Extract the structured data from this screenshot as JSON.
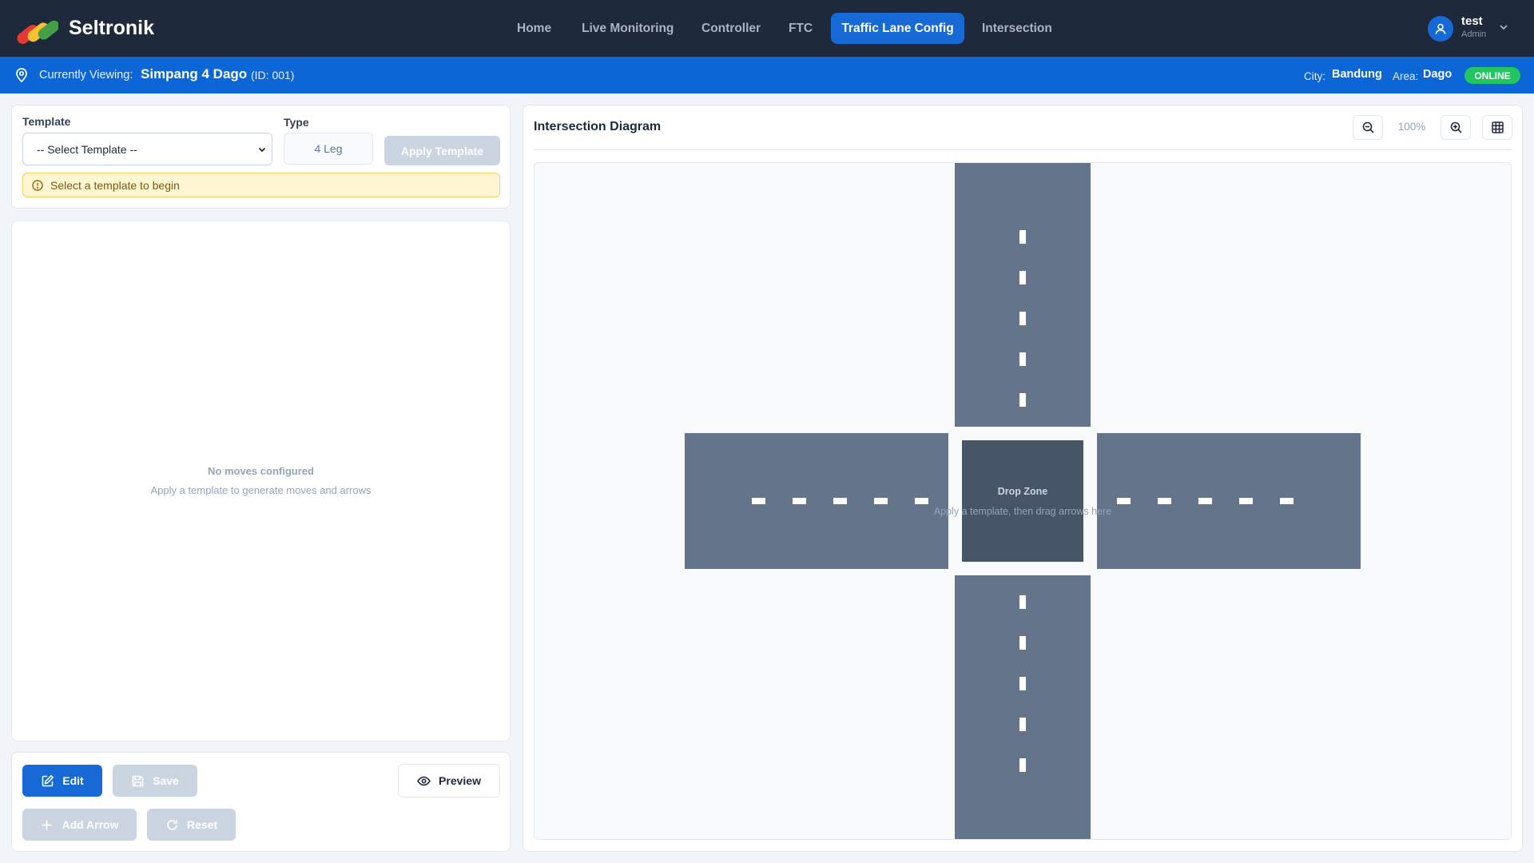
{
  "app": {
    "brand": "Seltronik"
  },
  "nav": [
    {
      "label": "Home",
      "active": false
    },
    {
      "label": "Live Monitoring",
      "active": false
    },
    {
      "label": "Controller",
      "active": false
    },
    {
      "label": "FTC",
      "active": false
    },
    {
      "label": "Traffic Lane Config",
      "active": true
    },
    {
      "label": "Intersection",
      "active": false
    }
  ],
  "user": {
    "name": "test",
    "role": "Admin",
    "icon": "user-icon"
  },
  "info": {
    "currently_viewing_label": "Currently Viewing:",
    "site_name": "Simpang 4 Dago",
    "site_id": "(ID: 001)",
    "city_label": "City:",
    "city": "Bandung",
    "area_label": "Area:",
    "area": "Dago",
    "status": "ONLINE"
  },
  "template_panel": {
    "template_label": "Template",
    "template_selected": "-- Select Template --",
    "type_label": "Type",
    "type_value": "4 Leg",
    "apply_label": "Apply Template",
    "alert": "Select a template to begin"
  },
  "moves_panel": {
    "empty_title": "No moves configured",
    "empty_subtitle": "Apply a template to generate moves and arrows"
  },
  "actions": {
    "edit": "Edit",
    "save": "Save",
    "preview": "Preview",
    "add_arrow": "Add Arrow",
    "reset": "Reset"
  },
  "diagram": {
    "title": "Intersection Diagram",
    "zoom": "100%",
    "drop_zone_title": "Drop Zone",
    "drop_zone_hint": "Apply a template, then drag arrows here"
  },
  "colors": {
    "nav_bg": "#1e293b",
    "accent": "#1769d6",
    "info_bar": "#0c66d6",
    "online": "#22c55e",
    "road": "#64748b",
    "drop_zone": "#475569"
  }
}
